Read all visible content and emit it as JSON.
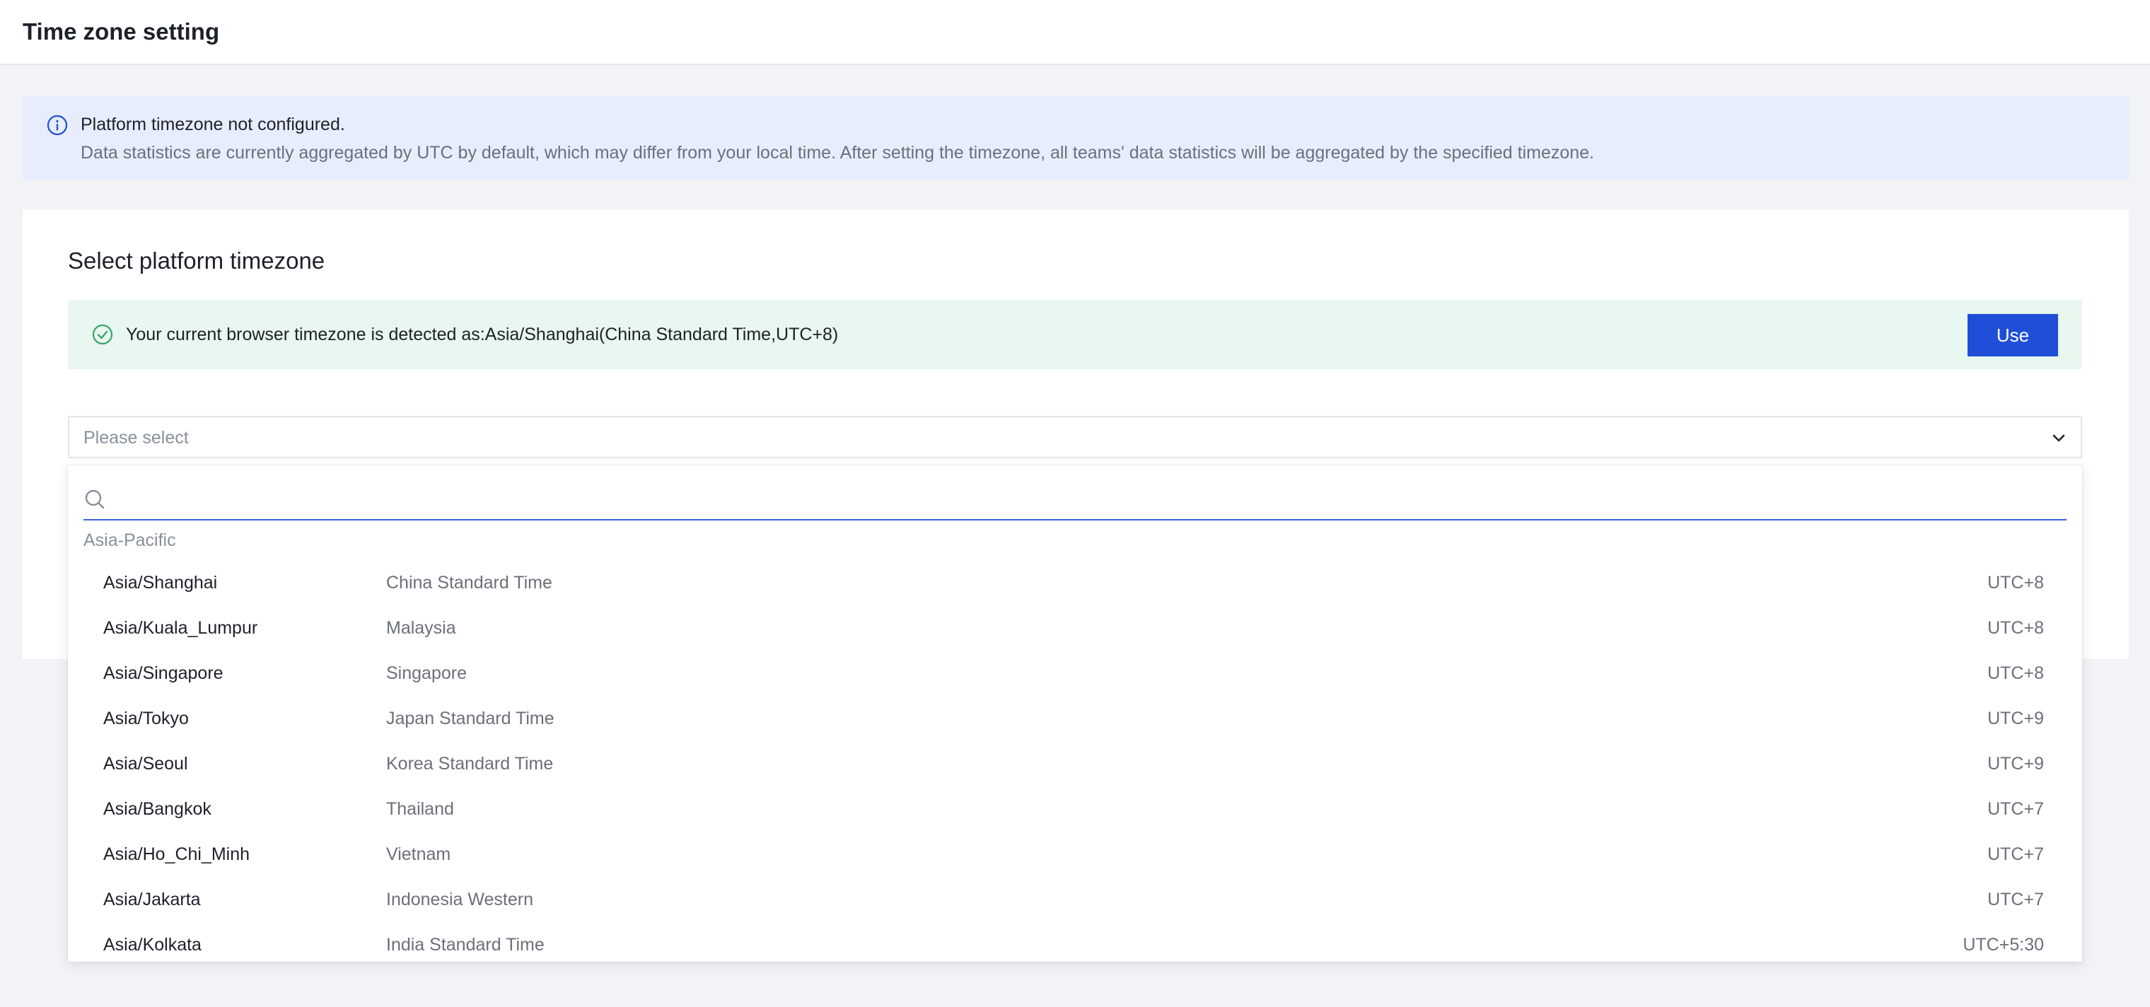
{
  "header": {
    "title": "Time zone setting"
  },
  "notice": {
    "icon": "info-icon",
    "title": "Platform timezone not configured.",
    "description": "Data statistics are currently aggregated by UTC by default, which may differ from your local time. After setting the timezone, all teams' data statistics will be aggregated by the specified timezone."
  },
  "timezone_section": {
    "title": "Select platform timezone",
    "detected": {
      "icon": "check-circle-icon",
      "text": "Your current browser timezone is detected as:Asia/Shanghai(China Standard Time,UTC+8)",
      "use_button": "Use"
    },
    "select": {
      "placeholder": "Please select",
      "icon": "chevron-down-icon"
    },
    "dropdown": {
      "search_placeholder": "",
      "search_icon": "search-icon",
      "group_label": "Asia-Pacific",
      "options": [
        {
          "id": "Asia/Shanghai",
          "name": "China Standard Time",
          "offset": "UTC+8"
        },
        {
          "id": "Asia/Kuala_Lumpur",
          "name": "Malaysia",
          "offset": "UTC+8"
        },
        {
          "id": "Asia/Singapore",
          "name": "Singapore",
          "offset": "UTC+8"
        },
        {
          "id": "Asia/Tokyo",
          "name": "Japan Standard Time",
          "offset": "UTC+9"
        },
        {
          "id": "Asia/Seoul",
          "name": "Korea Standard Time",
          "offset": "UTC+9"
        },
        {
          "id": "Asia/Bangkok",
          "name": "Thailand",
          "offset": "UTC+7"
        },
        {
          "id": "Asia/Ho_Chi_Minh",
          "name": "Vietnam",
          "offset": "UTC+7"
        },
        {
          "id": "Asia/Jakarta",
          "name": "Indonesia Western",
          "offset": "UTC+7"
        },
        {
          "id": "Asia/Kolkata",
          "name": "India Standard Time",
          "offset": "UTC+5:30"
        }
      ]
    }
  },
  "colors": {
    "accent": "#1f4fd6",
    "notice_bg": "#e8edfd",
    "success_bg": "#e8f7ef",
    "success_icon": "#3aa56b",
    "page_bg": "#f2f3f7"
  }
}
